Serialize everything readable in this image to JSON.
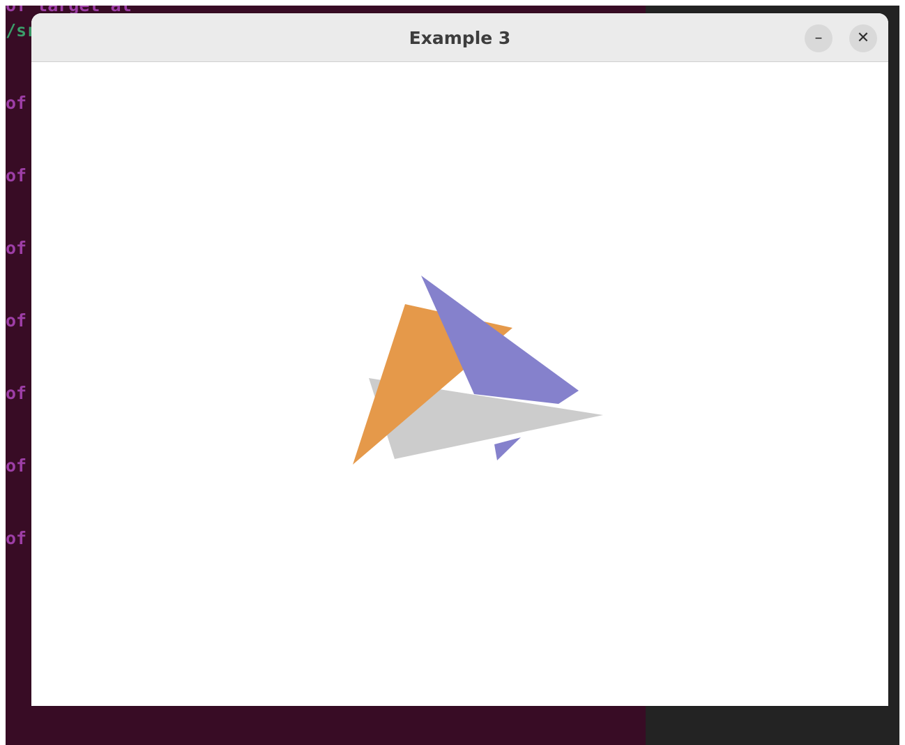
{
  "terminal": {
    "lines": [
      {
        "text": "of target al",
        "kind": "magenta"
      },
      {
        "text": "/sr",
        "kind": "green"
      },
      {
        "text": "of",
        "kind": "magenta"
      },
      {
        "text": "of",
        "kind": "magenta"
      },
      {
        "text": "of",
        "kind": "magenta"
      },
      {
        "text": "of",
        "kind": "magenta"
      },
      {
        "text": "of",
        "kind": "magenta"
      },
      {
        "text": "of",
        "kind": "magenta"
      },
      {
        "text": "of",
        "kind": "magenta"
      }
    ]
  },
  "window": {
    "title": "Example 3",
    "minimize_label": "–",
    "close_label": "✕"
  },
  "scene": {
    "triangles": [
      {
        "name": "gray-triangle",
        "color": "#cccccc"
      },
      {
        "name": "orange-triangle",
        "color": "#e5994a"
      },
      {
        "name": "purple-triangle",
        "color": "#8581cc"
      }
    ]
  }
}
